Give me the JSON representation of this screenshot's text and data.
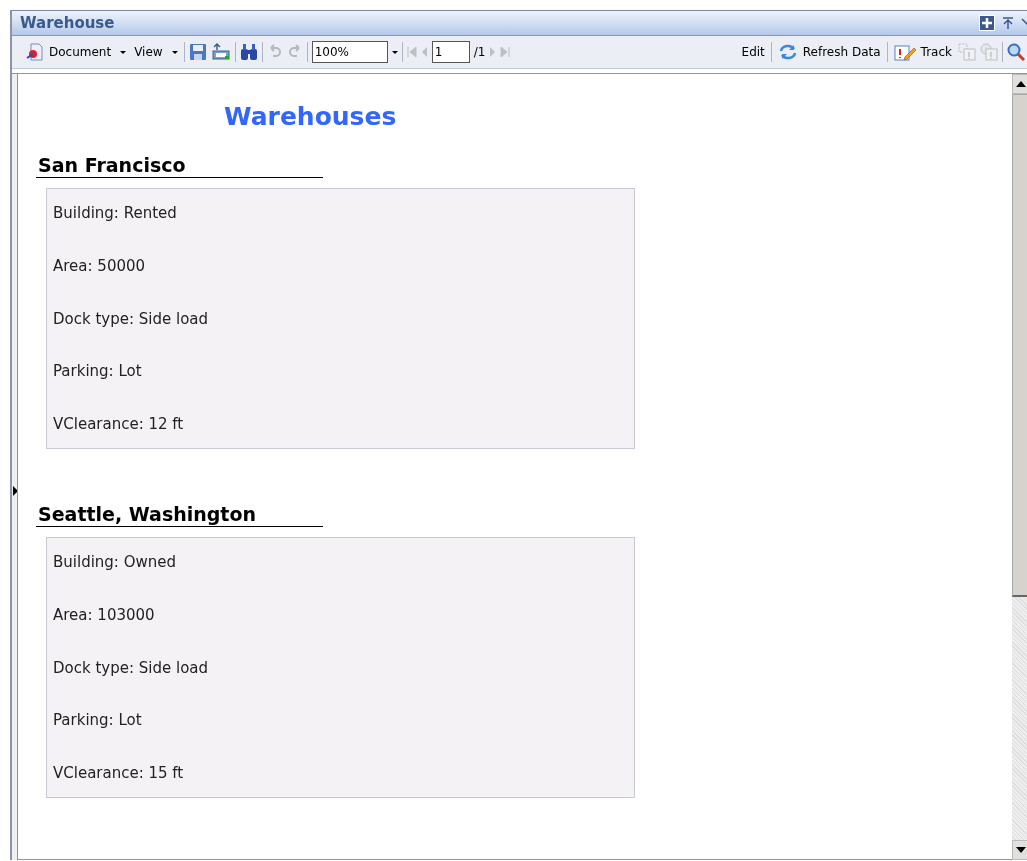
{
  "window": {
    "title": "Warehouse"
  },
  "toolbar": {
    "document_menu": "Document",
    "view_menu": "View",
    "undo": {
      "disabled": true
    },
    "redo": {
      "disabled": true
    },
    "zoom": "100%",
    "first_page": {
      "disabled": true
    },
    "prev_page": {
      "disabled": true
    },
    "page": "1",
    "page_total": "/1",
    "next_page": {
      "disabled": true
    },
    "last_page": {
      "disabled": true
    },
    "edit": "Edit",
    "refresh": "Refresh Data",
    "track": "Track",
    "track_prev": {
      "disabled": true
    },
    "track_info": {
      "disabled": true
    }
  },
  "report": {
    "title": "Warehouses",
    "warehouses": [
      {
        "name": "San Francisco",
        "fields": [
          "Building: Rented",
          "Area: 50000",
          "Dock type: Side load",
          "Parking: Lot",
          "VClearance: 12 ft"
        ]
      },
      {
        "name": "Seattle, Washington",
        "fields": [
          "Building: Owned",
          "Area: 103000",
          "Dock type: Side load",
          "Parking: Lot",
          "VClearance: 15 ft"
        ]
      }
    ]
  }
}
